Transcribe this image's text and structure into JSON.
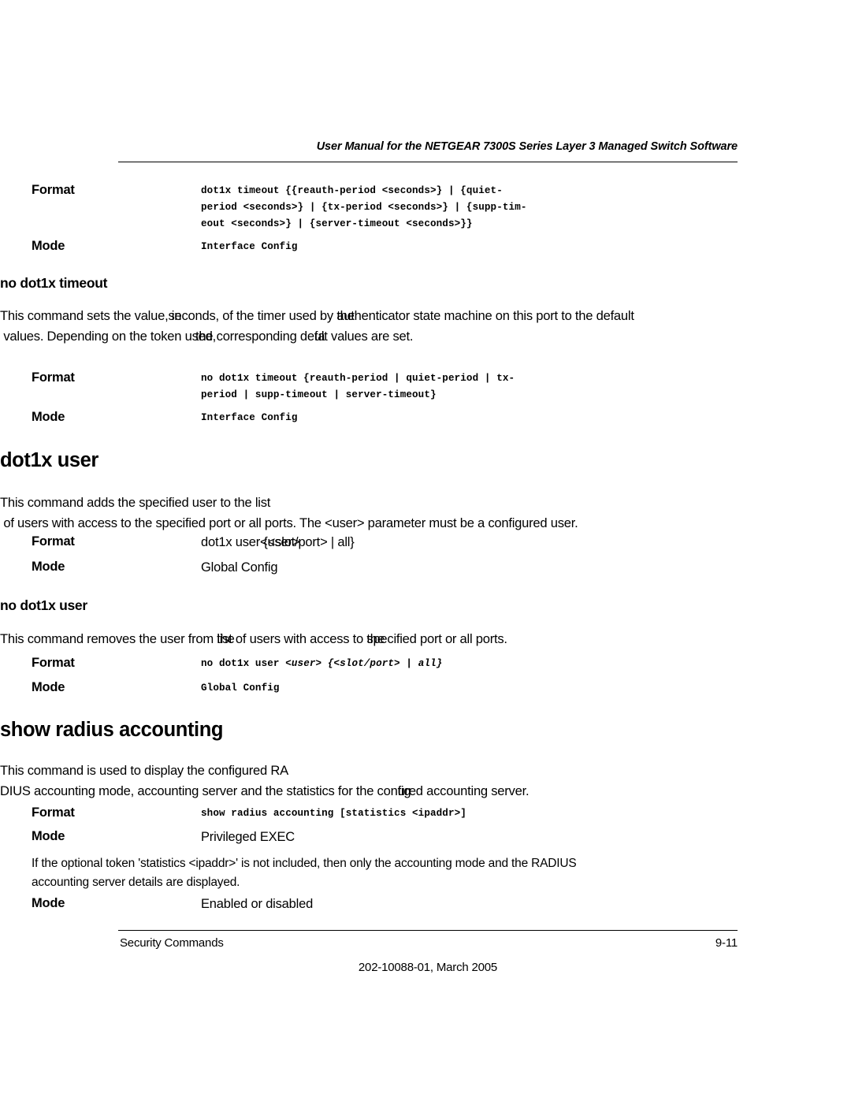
{
  "header": {
    "running_title": "User Manual for the NETGEAR 7300S Series Layer 3 Managed Switch Software"
  },
  "labels": {
    "format": "Format",
    "mode": "Mode"
  },
  "sections": [
    {
      "id": "dot1x-timeout-continued",
      "format_lines": [
        "dot1x timeout {{reauth-period <seconds>} | {quiet-",
        "period <seconds>} | {tx-period <seconds>} | {supp-tim-",
        "eout <seconds>} | {server-timeout <seconds>}}"
      ],
      "mode_value": "Interface Config"
    },
    {
      "id": "no-dot1x-timeout",
      "heading": "no dot1x timeout",
      "paragraph": {
        "seg_1": "This command sets the value",
        "ov_1a": ", in",
        "ov_1b": " seconds, of the timer used by",
        "ov_2a": " the",
        "ov_2b": " authenticator state machine on this port to the defa",
        "ov_3a": "ult",
        "ov_3b": " values. Depending on the token u",
        "ov_4a": "sed,",
        "ov_4b": " the corresponding de",
        "ov_5a": "fa",
        "ov_5b": "ult values are set."
      },
      "format_lines": [
        "no dot1x timeout {reauth-period | quiet-period | tx-",
        "period | supp-timeout | server-timeout}"
      ],
      "mode_value": "Interface Config"
    },
    {
      "id": "dot1x-user",
      "heading": "dot1x user",
      "paragraph": {
        "seg_1": "This command adds the specified user to the",
        "ov_1a": " list",
        "ov_1b": " of users with access to the specified port or all ports. The <user> parameter must be a configured user."
      },
      "format_value_pre": "dot1x user",
      "format_value_ov": "<user>",
      "format_value_post": " {<slot/port> | all}",
      "mode_value": "Global Config"
    },
    {
      "id": "no-dot1x-user",
      "heading": "no dot1x user",
      "paragraph": {
        "seg_1": "This command removes the user from",
        "ov_1a": " the",
        "ov_1b": " list of users with access to",
        "ov_2a": " the",
        "ov_2b": " specified port or all ports."
      },
      "format_mono_pre": "no dot1x user ",
      "format_mono_italic_user": "<user>",
      "format_mono_mid": " {<slot/port> | ",
      "format_mono_italic_all": "all",
      "format_mono_post": "}",
      "mode_value": "Global Config"
    },
    {
      "id": "show-radius-accounting",
      "heading": "show radius accounting",
      "paragraph": {
        "seg_1": "This command is used to display the configured",
        "ov_1a": " RA",
        "ov_1b": "DIUS accounting mode, accounting server and the statistics for the con",
        "ov_2a": "fig",
        "ov_2b": "ured accounting server."
      },
      "format_value": "show radius accounting [statistics <ipaddr>]",
      "mode_value": "Privileged EXEC",
      "note": "If the optional token 'statistics <ipaddr>' is not included, then only the accounting mode and the RADIUS accounting server details are displayed.",
      "mode_value_2": "Enabled or disabled"
    }
  ],
  "footer": {
    "left": "Security Commands",
    "page_number": "9-11",
    "center": "202-10088-01, March 2005"
  }
}
